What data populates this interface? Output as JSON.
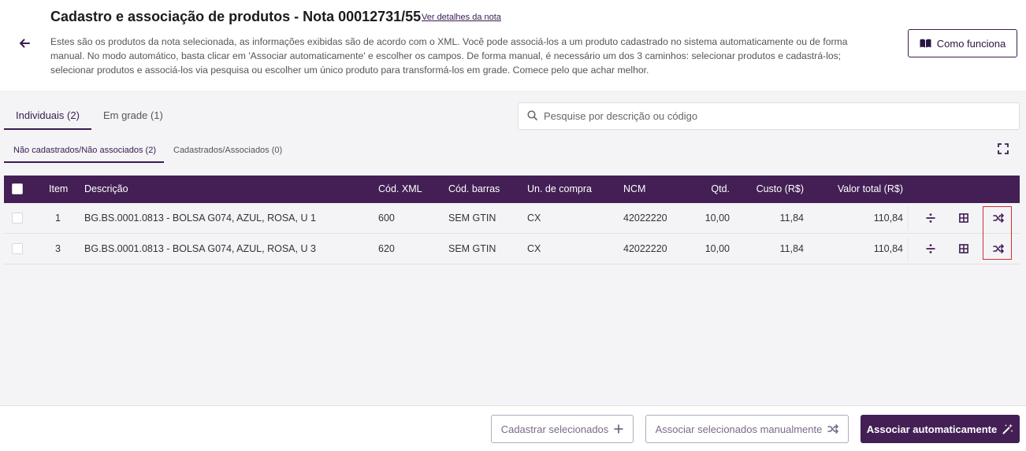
{
  "header": {
    "title": "Cadastro e associação de produtos - Nota 00012731/55",
    "details_link": "Ver detalhes da nota",
    "intro_line1": "Estes são os produtos da nota selecionada, as informações exibidas são de acordo com o XML. Você pode associá-los a um produto cadastrado no sistema automaticamente ou de forma",
    "intro_line2": "manual. No modo automático, basta clicar em 'Associar automaticamente' e escolher os campos. De forma manual, é necessário um dos 3 caminhos: selecionar produtos e cadastrá-los;",
    "intro_line3": "selecionar produtos e associá-los via pesquisa ou escolher um único produto para transformá-los em grade. Comece pelo que achar melhor.",
    "how_button": "Como funciona"
  },
  "tabs": [
    {
      "label": "Individuais (2)",
      "active": true
    },
    {
      "label": "Em grade (1)",
      "active": false
    }
  ],
  "search": {
    "placeholder": "Pesquise por descrição ou código"
  },
  "subtabs": [
    {
      "label": "Não cadastrados/Não associados (2)",
      "active": true
    },
    {
      "label": "Cadastrados/Associados (0)",
      "active": false
    }
  ],
  "table": {
    "columns": [
      "Item",
      "Descrição",
      "Cód. XML",
      "Cód. barras",
      "Un. de compra",
      "NCM",
      "Qtd.",
      "Custo (R$)",
      "Valor total (R$)"
    ],
    "rows": [
      {
        "item": "1",
        "descricao": "BG.BS.0001.0813 - BOLSA G074, AZUL, ROSA, U 1",
        "cod_xml": "600",
        "cod_barras": "SEM GTIN",
        "un_compra": "CX",
        "ncm": "42022220",
        "qtd": "10,00",
        "custo": "11,84",
        "valor_total": "110,84"
      },
      {
        "item": "3",
        "descricao": "BG.BS.0001.0813 - BOLSA G074, AZUL, ROSA, U 3",
        "cod_xml": "620",
        "cod_barras": "SEM GTIN",
        "un_compra": "CX",
        "ncm": "42022220",
        "qtd": "10,00",
        "custo": "11,84",
        "valor_total": "110,84"
      }
    ]
  },
  "footer": {
    "cadastrar": "Cadastrar selecionados",
    "associar_manual": "Associar selecionados manualmente",
    "associar_auto": "Associar automaticamente"
  },
  "colors": {
    "primary": "#431f55",
    "highlight": "#d32f2f",
    "page_bg": "#f4f4f6"
  },
  "icons": [
    "back-arrow-icon",
    "book-icon",
    "search-icon",
    "expand-icon",
    "divide-icon",
    "grid-icon",
    "shuffle-icon",
    "plus-icon",
    "magic-wand-icon"
  ]
}
